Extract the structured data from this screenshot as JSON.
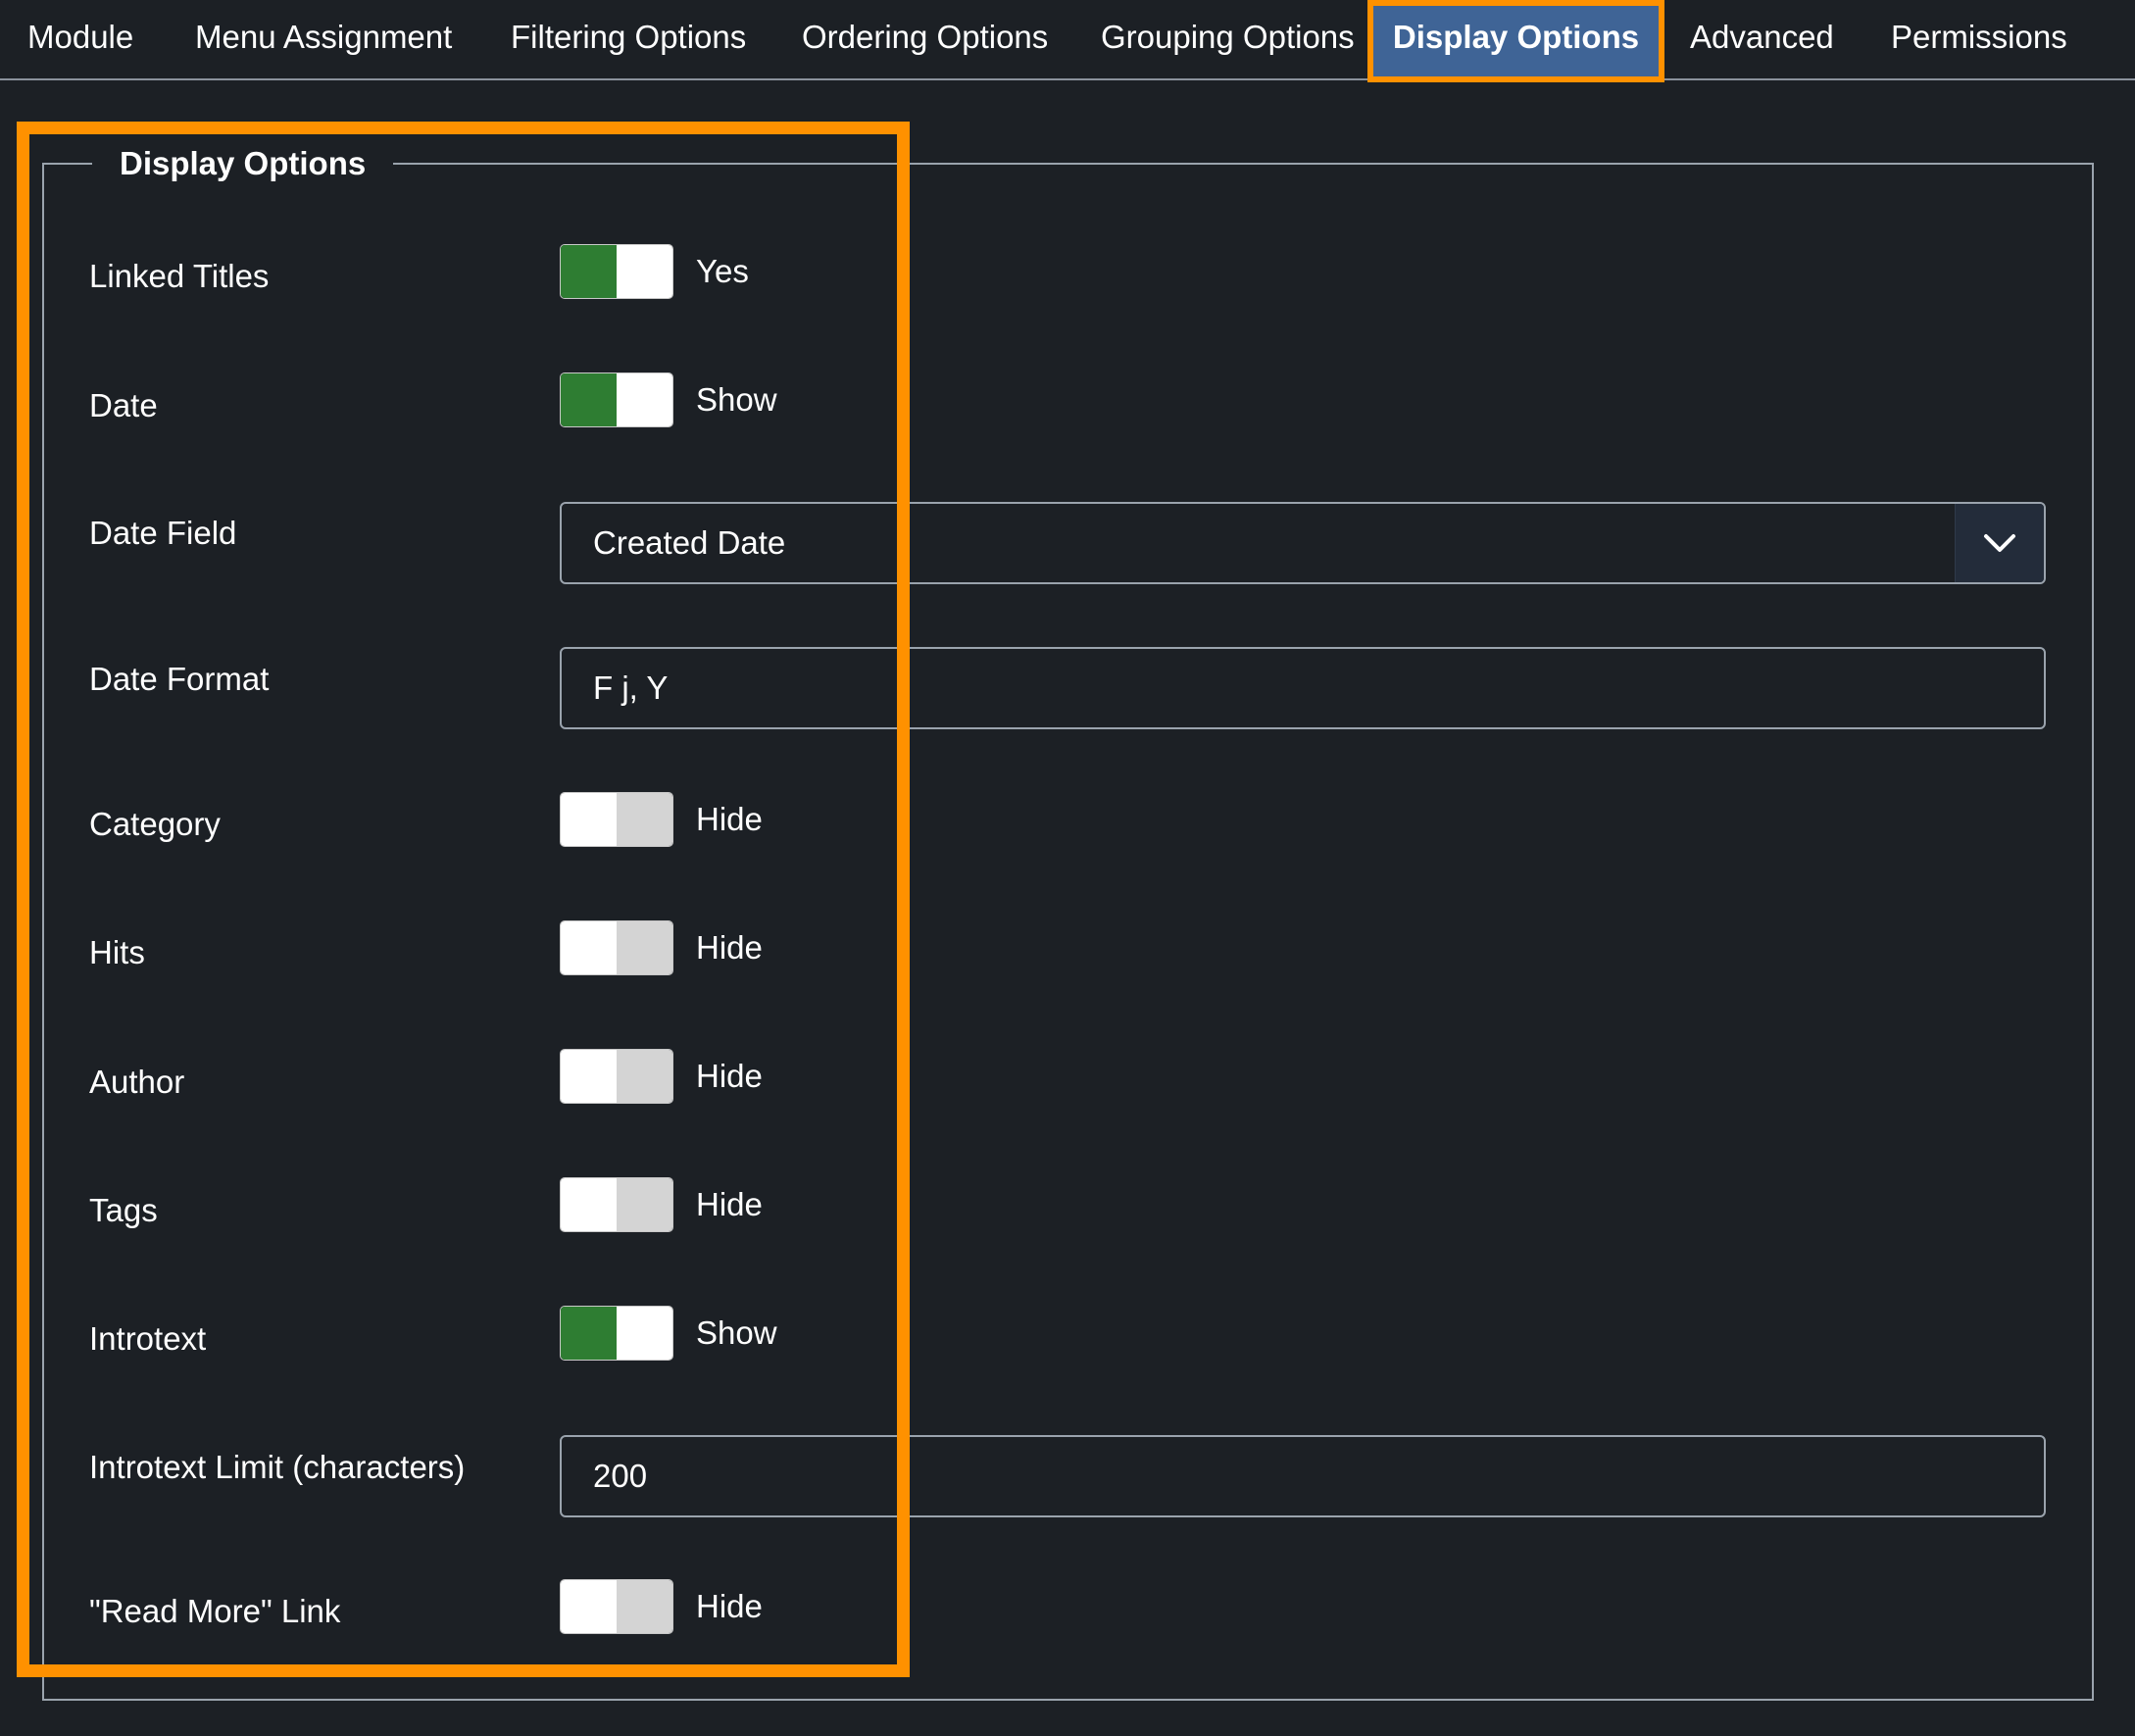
{
  "tabs": [
    {
      "label": "Module"
    },
    {
      "label": "Menu Assignment"
    },
    {
      "label": "Filtering Options"
    },
    {
      "label": "Ordering Options"
    },
    {
      "label": "Grouping Options"
    },
    {
      "label": "Display Options",
      "active": true
    },
    {
      "label": "Advanced"
    },
    {
      "label": "Permissions"
    }
  ],
  "section": {
    "legend": "Display Options"
  },
  "fields": {
    "linked_titles": {
      "label": "Linked Titles",
      "state": "on",
      "value_text": "Yes"
    },
    "date": {
      "label": "Date",
      "state": "on",
      "value_text": "Show"
    },
    "date_field": {
      "label": "Date Field",
      "selected": "Created Date"
    },
    "date_format": {
      "label": "Date Format",
      "value": "F j, Y"
    },
    "category": {
      "label": "Category",
      "state": "off",
      "value_text": "Hide"
    },
    "hits": {
      "label": "Hits",
      "state": "off",
      "value_text": "Hide"
    },
    "author": {
      "label": "Author",
      "state": "off",
      "value_text": "Hide"
    },
    "tags": {
      "label": "Tags",
      "state": "off",
      "value_text": "Hide"
    },
    "introtext": {
      "label": "Introtext",
      "state": "on",
      "value_text": "Show"
    },
    "introtext_limit": {
      "label": "Introtext Limit (characters)",
      "value": "200"
    },
    "read_more": {
      "label": "\"Read More\" Link",
      "state": "off",
      "value_text": "Hide"
    }
  },
  "colors": {
    "background": "#1c2025",
    "active_tab": "#3f6496",
    "highlight": "#ff9100",
    "switch_on": "#2e7d32",
    "border": "#9aa3ad"
  },
  "icons": {
    "select_arrow": "chevron-down-icon"
  }
}
